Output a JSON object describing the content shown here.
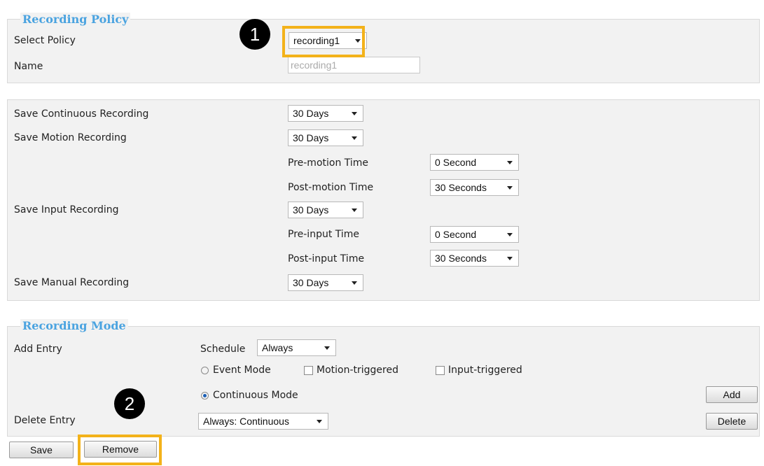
{
  "recording_policy": {
    "legend": "Recording Policy",
    "select_policy_label": "Select Policy",
    "select_policy_value": "recording1",
    "name_label": "Name",
    "name_value": "recording1"
  },
  "retention": {
    "continuous_label": "Save Continuous Recording",
    "continuous_value": "30 Days",
    "motion_label": "Save Motion Recording",
    "motion_value": "30 Days",
    "pre_motion_label": "Pre-motion Time",
    "pre_motion_value": "0 Second",
    "post_motion_label": "Post-motion Time",
    "post_motion_value": "30 Seconds",
    "input_label": "Save Input Recording",
    "input_value": "30 Days",
    "pre_input_label": "Pre-input Time",
    "pre_input_value": "0 Second",
    "post_input_label": "Post-input Time",
    "post_input_value": "30 Seconds",
    "manual_label": "Save Manual Recording",
    "manual_value": "30 Days"
  },
  "recording_mode": {
    "legend": "Recording Mode",
    "add_entry_label": "Add Entry",
    "schedule_label": "Schedule",
    "schedule_value": "Always",
    "event_mode_label": "Event Mode",
    "event_mode_selected": false,
    "motion_triggered_label": "Motion-triggered",
    "motion_triggered_checked": false,
    "input_triggered_label": "Input-triggered",
    "input_triggered_checked": false,
    "continuous_mode_label": "Continuous Mode",
    "continuous_mode_selected": true,
    "add_button": "Add",
    "delete_entry_label": "Delete Entry",
    "delete_entry_value": "Always: Continuous",
    "delete_button": "Delete"
  },
  "footer": {
    "save_button": "Save",
    "remove_button": "Remove"
  },
  "annotations": {
    "callout_1": "1",
    "callout_2": "2",
    "highlight_color": "#f3b21a"
  }
}
